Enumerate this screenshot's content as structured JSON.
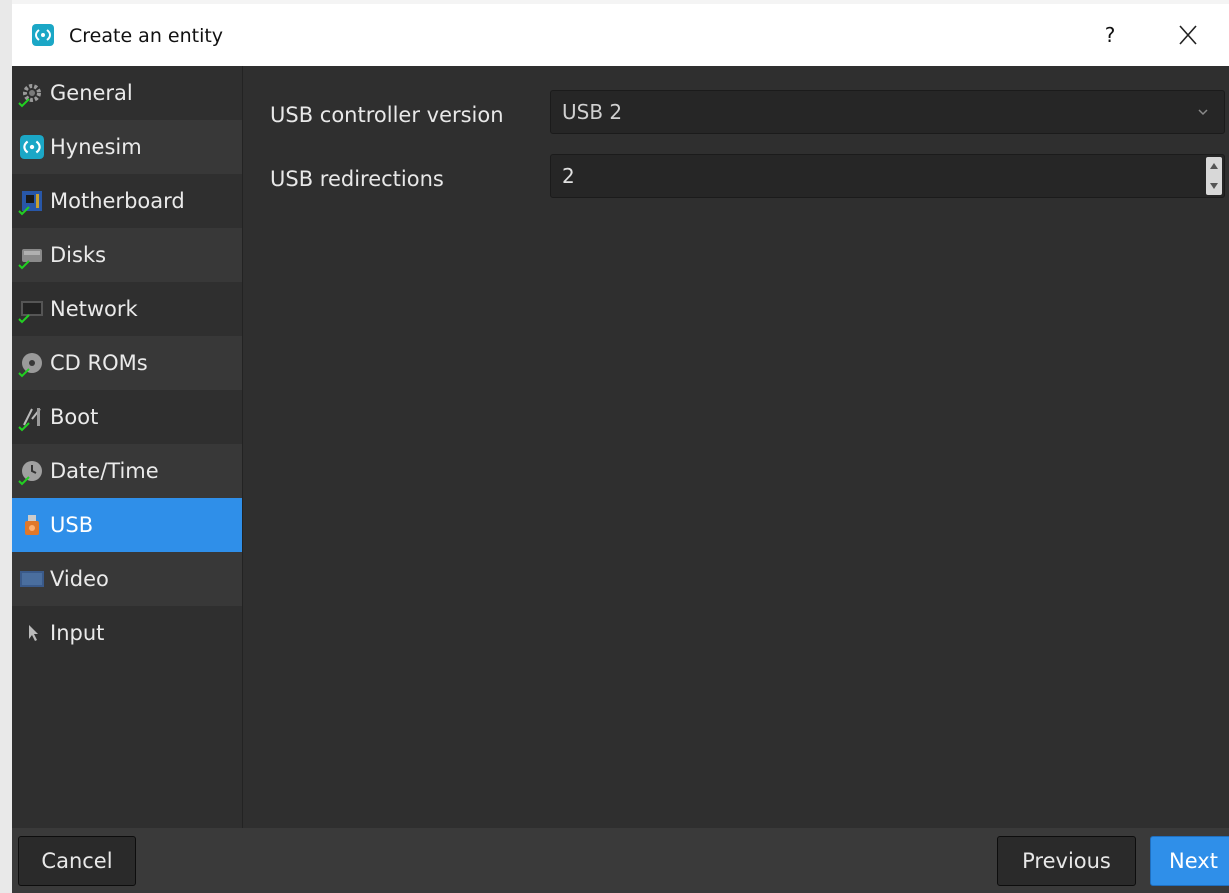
{
  "window": {
    "title": "Create an entity",
    "help_label": "?",
    "accent_color": "#2f8fe9"
  },
  "sidebar": {
    "items": [
      {
        "label": "General",
        "icon": "gear-icon",
        "checked": true
      },
      {
        "label": "Hynesim",
        "icon": "hynesim-logo-icon",
        "checked": false
      },
      {
        "label": "Motherboard",
        "icon": "motherboard-icon",
        "checked": true
      },
      {
        "label": "Disks",
        "icon": "disk-icon",
        "checked": true
      },
      {
        "label": "Network",
        "icon": "network-icon",
        "checked": true
      },
      {
        "label": "CD ROMs",
        "icon": "cdrom-icon",
        "checked": true
      },
      {
        "label": "Boot",
        "icon": "boot-icon",
        "checked": true
      },
      {
        "label": "Date/Time",
        "icon": "clock-icon",
        "checked": true
      },
      {
        "label": "USB",
        "icon": "usb-icon",
        "checked": false,
        "active": true
      },
      {
        "label": "Video",
        "icon": "video-icon",
        "checked": false
      },
      {
        "label": "Input",
        "icon": "cursor-icon",
        "checked": false
      }
    ]
  },
  "form": {
    "usb_controller_label": "USB controller version",
    "usb_controller_value": "USB 2",
    "usb_redirections_label": "USB redirections",
    "usb_redirections_value": "2"
  },
  "footer": {
    "cancel_label": "Cancel",
    "previous_label": "Previous",
    "next_label": "Next"
  }
}
